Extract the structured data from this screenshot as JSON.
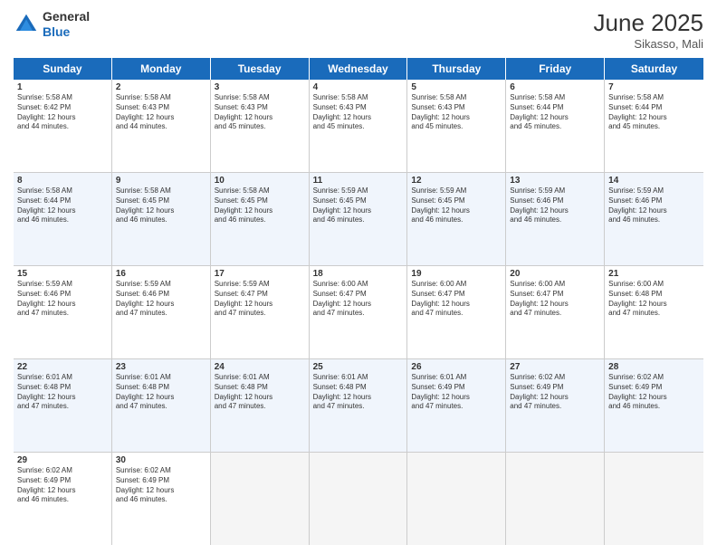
{
  "header": {
    "logo_general": "General",
    "logo_blue": "Blue",
    "month_year": "June 2025",
    "location": "Sikasso, Mali"
  },
  "days_of_week": [
    "Sunday",
    "Monday",
    "Tuesday",
    "Wednesday",
    "Thursday",
    "Friday",
    "Saturday"
  ],
  "weeks": [
    [
      {
        "day": "1",
        "lines": [
          "Sunrise: 5:58 AM",
          "Sunset: 6:42 PM",
          "Daylight: 12 hours",
          "and 44 minutes."
        ]
      },
      {
        "day": "2",
        "lines": [
          "Sunrise: 5:58 AM",
          "Sunset: 6:43 PM",
          "Daylight: 12 hours",
          "and 44 minutes."
        ]
      },
      {
        "day": "3",
        "lines": [
          "Sunrise: 5:58 AM",
          "Sunset: 6:43 PM",
          "Daylight: 12 hours",
          "and 45 minutes."
        ]
      },
      {
        "day": "4",
        "lines": [
          "Sunrise: 5:58 AM",
          "Sunset: 6:43 PM",
          "Daylight: 12 hours",
          "and 45 minutes."
        ]
      },
      {
        "day": "5",
        "lines": [
          "Sunrise: 5:58 AM",
          "Sunset: 6:43 PM",
          "Daylight: 12 hours",
          "and 45 minutes."
        ]
      },
      {
        "day": "6",
        "lines": [
          "Sunrise: 5:58 AM",
          "Sunset: 6:44 PM",
          "Daylight: 12 hours",
          "and 45 minutes."
        ]
      },
      {
        "day": "7",
        "lines": [
          "Sunrise: 5:58 AM",
          "Sunset: 6:44 PM",
          "Daylight: 12 hours",
          "and 45 minutes."
        ]
      }
    ],
    [
      {
        "day": "8",
        "lines": [
          "Sunrise: 5:58 AM",
          "Sunset: 6:44 PM",
          "Daylight: 12 hours",
          "and 46 minutes."
        ]
      },
      {
        "day": "9",
        "lines": [
          "Sunrise: 5:58 AM",
          "Sunset: 6:45 PM",
          "Daylight: 12 hours",
          "and 46 minutes."
        ]
      },
      {
        "day": "10",
        "lines": [
          "Sunrise: 5:58 AM",
          "Sunset: 6:45 PM",
          "Daylight: 12 hours",
          "and 46 minutes."
        ]
      },
      {
        "day": "11",
        "lines": [
          "Sunrise: 5:59 AM",
          "Sunset: 6:45 PM",
          "Daylight: 12 hours",
          "and 46 minutes."
        ]
      },
      {
        "day": "12",
        "lines": [
          "Sunrise: 5:59 AM",
          "Sunset: 6:45 PM",
          "Daylight: 12 hours",
          "and 46 minutes."
        ]
      },
      {
        "day": "13",
        "lines": [
          "Sunrise: 5:59 AM",
          "Sunset: 6:46 PM",
          "Daylight: 12 hours",
          "and 46 minutes."
        ]
      },
      {
        "day": "14",
        "lines": [
          "Sunrise: 5:59 AM",
          "Sunset: 6:46 PM",
          "Daylight: 12 hours",
          "and 46 minutes."
        ]
      }
    ],
    [
      {
        "day": "15",
        "lines": [
          "Sunrise: 5:59 AM",
          "Sunset: 6:46 PM",
          "Daylight: 12 hours",
          "and 47 minutes."
        ]
      },
      {
        "day": "16",
        "lines": [
          "Sunrise: 5:59 AM",
          "Sunset: 6:46 PM",
          "Daylight: 12 hours",
          "and 47 minutes."
        ]
      },
      {
        "day": "17",
        "lines": [
          "Sunrise: 5:59 AM",
          "Sunset: 6:47 PM",
          "Daylight: 12 hours",
          "and 47 minutes."
        ]
      },
      {
        "day": "18",
        "lines": [
          "Sunrise: 6:00 AM",
          "Sunset: 6:47 PM",
          "Daylight: 12 hours",
          "and 47 minutes."
        ]
      },
      {
        "day": "19",
        "lines": [
          "Sunrise: 6:00 AM",
          "Sunset: 6:47 PM",
          "Daylight: 12 hours",
          "and 47 minutes."
        ]
      },
      {
        "day": "20",
        "lines": [
          "Sunrise: 6:00 AM",
          "Sunset: 6:47 PM",
          "Daylight: 12 hours",
          "and 47 minutes."
        ]
      },
      {
        "day": "21",
        "lines": [
          "Sunrise: 6:00 AM",
          "Sunset: 6:48 PM",
          "Daylight: 12 hours",
          "and 47 minutes."
        ]
      }
    ],
    [
      {
        "day": "22",
        "lines": [
          "Sunrise: 6:01 AM",
          "Sunset: 6:48 PM",
          "Daylight: 12 hours",
          "and 47 minutes."
        ]
      },
      {
        "day": "23",
        "lines": [
          "Sunrise: 6:01 AM",
          "Sunset: 6:48 PM",
          "Daylight: 12 hours",
          "and 47 minutes."
        ]
      },
      {
        "day": "24",
        "lines": [
          "Sunrise: 6:01 AM",
          "Sunset: 6:48 PM",
          "Daylight: 12 hours",
          "and 47 minutes."
        ]
      },
      {
        "day": "25",
        "lines": [
          "Sunrise: 6:01 AM",
          "Sunset: 6:48 PM",
          "Daylight: 12 hours",
          "and 47 minutes."
        ]
      },
      {
        "day": "26",
        "lines": [
          "Sunrise: 6:01 AM",
          "Sunset: 6:49 PM",
          "Daylight: 12 hours",
          "and 47 minutes."
        ]
      },
      {
        "day": "27",
        "lines": [
          "Sunrise: 6:02 AM",
          "Sunset: 6:49 PM",
          "Daylight: 12 hours",
          "and 47 minutes."
        ]
      },
      {
        "day": "28",
        "lines": [
          "Sunrise: 6:02 AM",
          "Sunset: 6:49 PM",
          "Daylight: 12 hours",
          "and 46 minutes."
        ]
      }
    ],
    [
      {
        "day": "29",
        "lines": [
          "Sunrise: 6:02 AM",
          "Sunset: 6:49 PM",
          "Daylight: 12 hours",
          "and 46 minutes."
        ]
      },
      {
        "day": "30",
        "lines": [
          "Sunrise: 6:02 AM",
          "Sunset: 6:49 PM",
          "Daylight: 12 hours",
          "and 46 minutes."
        ]
      },
      {
        "day": "",
        "lines": []
      },
      {
        "day": "",
        "lines": []
      },
      {
        "day": "",
        "lines": []
      },
      {
        "day": "",
        "lines": []
      },
      {
        "day": "",
        "lines": []
      }
    ]
  ]
}
